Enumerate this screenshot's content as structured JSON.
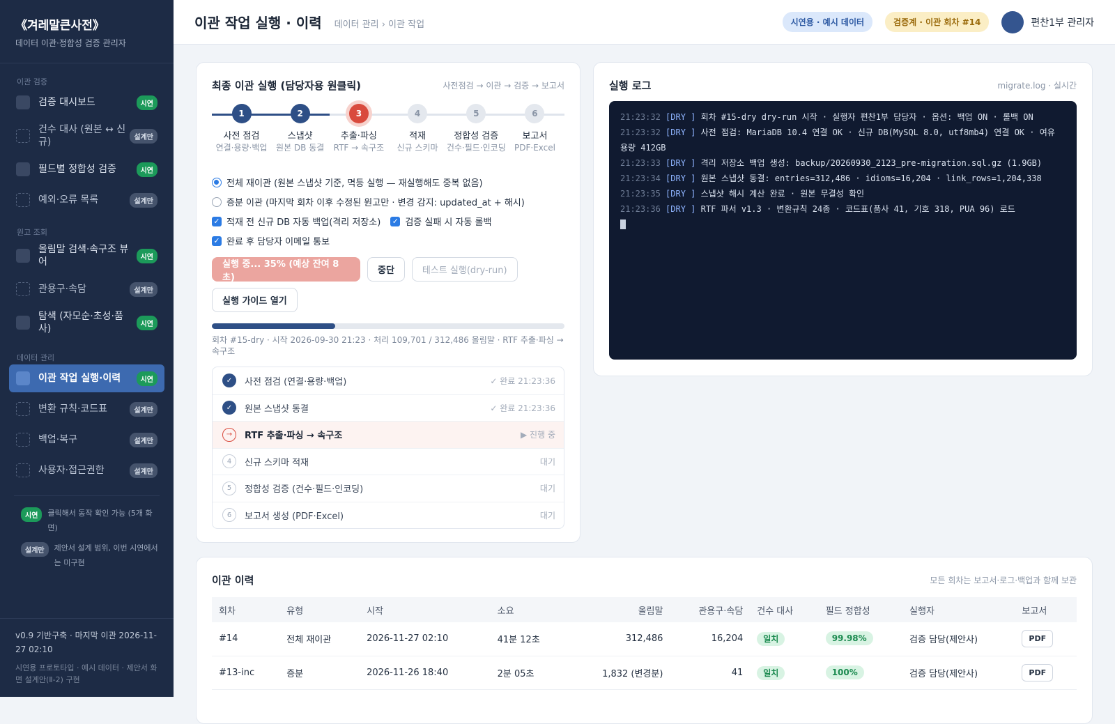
{
  "sidebar": {
    "title": "《겨레말큰사전》",
    "subtitle": "데이터 이관·정합성 검증 관리자",
    "sections": [
      {
        "label": "이관 검증",
        "items": [
          {
            "label": "검증 대시보드",
            "badge": "시연",
            "kind": "demo"
          },
          {
            "label": "건수 대사 (원본 ↔ 신규)",
            "badge": "설계만",
            "kind": "plan"
          },
          {
            "label": "필드별 정합성 검증",
            "badge": "시연",
            "kind": "demo"
          },
          {
            "label": "예외·오류 목록",
            "badge": "설계만",
            "kind": "plan"
          }
        ]
      },
      {
        "label": "원고 조회",
        "items": [
          {
            "label": "올림말 검색·속구조 뷰어",
            "badge": "시연",
            "kind": "demo"
          },
          {
            "label": "관용구·속담",
            "badge": "설계만",
            "kind": "plan"
          },
          {
            "label": "탐색 (자모순·초성·품사)",
            "badge": "시연",
            "kind": "demo"
          }
        ]
      },
      {
        "label": "데이터 관리",
        "items": [
          {
            "label": "이관 작업 실행·이력",
            "badge": "시연",
            "kind": "demo",
            "active": true
          },
          {
            "label": "변환 규칙·코드표",
            "badge": "설계만",
            "kind": "plan"
          },
          {
            "label": "백업·복구",
            "badge": "설계만",
            "kind": "plan"
          },
          {
            "label": "사용자·접근권한",
            "badge": "설계만",
            "kind": "plan"
          }
        ]
      }
    ],
    "legend": [
      {
        "badge": "시연",
        "text": "클릭해서 동작 확인 가능 (5개 화면)"
      },
      {
        "badge": "설계만",
        "text": "제안서 설계 범위, 이번 시연에서는 미구현"
      }
    ],
    "footer_version": "v0.9 기반구축 · 마지막 이관 2026-11-27 02:10",
    "footer_note": "시연용 프로토타입 · 예시 데이터 · 제안서 화면 설계안(Ⅱ-2) 구현"
  },
  "topbar": {
    "title": "이관 작업 실행 · 이력",
    "breadcrumb": "데이터 관리 › 이관 작업",
    "pill_demo": "시연용 · 예시 데이터",
    "pill_env": "검증계 · 이관 회차 #14",
    "user": "편찬1부 관리자"
  },
  "run_card": {
    "title": "최종 이관 실행 (담당자용 원클릭)",
    "flow": "사전점검 → 이관 → 검증 → 보고서",
    "steps": [
      {
        "n": "1",
        "title": "사전 점검",
        "sub": "연결·용량·백업",
        "state": "done"
      },
      {
        "n": "2",
        "title": "스냅샷",
        "sub": "원본 DB 동결",
        "state": "done"
      },
      {
        "n": "3",
        "title": "추출·파싱",
        "sub": "RTF → 속구조",
        "state": "cur"
      },
      {
        "n": "4",
        "title": "적재",
        "sub": "신규 스키마",
        "state": "todo"
      },
      {
        "n": "5",
        "title": "정합성 검증",
        "sub": "건수·필드·인코딩",
        "state": "todo"
      },
      {
        "n": "6",
        "title": "보고서",
        "sub": "PDF·Excel",
        "state": "todo"
      }
    ],
    "option_full": "전체 재이관 (원본 스냅샷 기준, 멱등 실행 — 재실행해도 중복 없음)",
    "option_incr": "증분 이관 (마지막 회차 이후 수정된 원고만 · 변경 감지: updated_at + 해시)",
    "chk_backup": "적재 전 신규 DB 자동 백업(격리 저장소)",
    "chk_rollback": "검증 실패 시 자동 롤백",
    "chk_email": "완료 후 담당자 이메일 통보",
    "btn_running": "실행 중... 35% (예상 잔여 8초)",
    "btn_stop": "중단",
    "btn_dryrun": "테스트 실행(dry-run)",
    "btn_guide": "실행 가이드 열기",
    "progress": 0.35,
    "progress_text": "회차 #15-dry · 시작 2026-09-30 21:23 · 처리 109,701 / 312,486 올림말 · RTF 추출·파싱 → 속구조",
    "tasks": [
      {
        "icon": "✓",
        "label": "사전 점검 (연결·용량·백업)",
        "status": "✓ 완료 21:23:36",
        "state": "ok"
      },
      {
        "icon": "✓",
        "label": "원본 스냅샷 동결",
        "status": "✓ 완료 21:23:36",
        "state": "ok"
      },
      {
        "icon": "→",
        "label": "RTF 추출·파싱 → 속구조",
        "status": "▶ 진행 중",
        "state": "run"
      },
      {
        "icon": "4",
        "label": "신규 스키마 적재",
        "status": "대기",
        "state": "wait"
      },
      {
        "icon": "5",
        "label": "정합성 검증 (건수·필드·인코딩)",
        "status": "대기",
        "state": "wait"
      },
      {
        "icon": "6",
        "label": "보고서 생성 (PDF·Excel)",
        "status": "대기",
        "state": "wait"
      }
    ]
  },
  "log_card": {
    "title": "실행 로그",
    "hint": "migrate.log · 실시간",
    "lines": [
      {
        "time": "21:23:32",
        "tag": "[DRY ]",
        "text": "회차 #15-dry dry-run 시작 · 실행자 편찬1부 담당자 · 옵션: 백업 ON · 롤백 ON"
      },
      {
        "time": "21:23:32",
        "tag": "[DRY ]",
        "text": "사전 점검: MariaDB 10.4 연결 OK · 신규 DB(MySQL 8.0, utf8mb4) 연결 OK · 여유 용량 412GB"
      },
      {
        "time": "21:23:33",
        "tag": "[DRY ]",
        "text": "격리 저장소 백업 생성: backup/20260930_2123_pre-migration.sql.gz (1.9GB)"
      },
      {
        "time": "21:23:34",
        "tag": "[DRY ]",
        "text": "원본 스냅샷 동결: entries=312,486 · idioms=16,204 · link_rows=1,204,338"
      },
      {
        "time": "21:23:35",
        "tag": "[DRY ]",
        "text": "스냅샷 해시 계산 완료 · 원본 무결성 확인"
      },
      {
        "time": "21:23:36",
        "tag": "[DRY ]",
        "text": "RTF 파서 v1.3 · 변환규칙 24종 · 코드표(품사 41, 기호 318, PUA 96) 로드"
      }
    ]
  },
  "history": {
    "title": "이관 이력",
    "hint": "모든 회차는 보고서·로그·백업과 함께 보관",
    "columns": [
      "회차",
      "유형",
      "시작",
      "소요",
      "올림말",
      "관용구·속담",
      "건수 대사",
      "필드 정합성",
      "실행자",
      "보고서"
    ],
    "rows": [
      {
        "round": "#14",
        "type": "전체 재이관",
        "start": "2026-11-27 02:10",
        "duration": "41분 12초",
        "entries": "312,486",
        "idioms": "16,204",
        "count": "일치",
        "field": "99.98%",
        "runner": "검증 담당(제안사)",
        "report": "PDF"
      },
      {
        "round": "#13-inc",
        "type": "증분",
        "start": "2026-11-26 18:40",
        "duration": "2분 05초",
        "entries": "1,832 (변경분)",
        "idioms": "41",
        "count": "일치",
        "field": "100%",
        "runner": "검증 담당(제안사)",
        "report": "PDF"
      }
    ]
  }
}
